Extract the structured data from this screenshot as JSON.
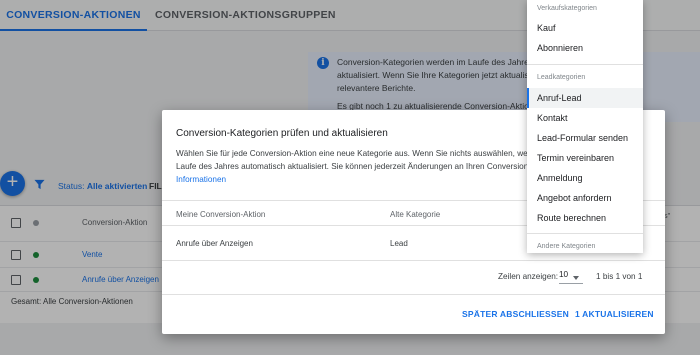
{
  "tabs": [
    {
      "label": "CONVERSION-AKTIONEN",
      "active": true
    },
    {
      "label": "CONVERSION-AKTIONSGRUPPEN",
      "active": false
    }
  ],
  "info": {
    "line1": "Conversion-Kategorien werden im Laufe des Jahres",
    "line2": "aktualisiert. Wenn Sie Ihre Kategorien jetzt aktualisie",
    "line3": "relevantere Berichte.",
    "line4": "Es gibt noch 1 zu aktualisierende Conversion-Aktion"
  },
  "toolbar": {
    "add_label": "+",
    "status_prefix": "Status:",
    "status_value": "Alle aktivierten",
    "filter_label": "FIL"
  },
  "table": {
    "header": "Conversion-Aktion",
    "rows": [
      {
        "name": "Vente",
        "status_color": "#1e8e3e"
      },
      {
        "name": "Anrufe über Anzeigen",
        "status_color": "#1e8e3e"
      }
    ],
    "total": "Gesamt: Alle Conversion-Aktionen",
    "right_col_line1": "nsions\"",
    "right_col_line2": "en"
  },
  "modal": {
    "title": "Conversion-Kategorien prüfen und aktualisieren",
    "desc_line1": "Wählen Sie für jede Conversion-Aktion eine neue Kategorie aus. Wenn Sie nichts auswählen, wer",
    "desc_line2": "Laufe des Jahres automatisch aktualisiert. Sie können jederzeit Änderungen an Ihren Conversion",
    "desc_link": "Informationen",
    "col_action": "Meine Conversion-Aktion",
    "col_old": "Alte Kategorie",
    "row_action": "Anrufe über Anzeigen",
    "row_old": "Lead",
    "rows_label": "Zeilen anzeigen:",
    "rows_value": "10",
    "range": "1 bis 1 von 1",
    "btn_later": "SPÄTER ABSCHLIESSEN",
    "btn_update": "1 AKTUALISIEREN"
  },
  "menu": {
    "group1": "Verkaufskategorien",
    "items1": [
      "Kauf",
      "Abonnieren"
    ],
    "group2": "Leadkategorien",
    "items2": [
      "Anruf-Lead",
      "Kontakt",
      "Lead-Formular senden",
      "Termin vereinbaren",
      "Anmeldung",
      "Angebot anfordern",
      "Route berechnen"
    ],
    "selected": "Anruf-Lead",
    "group3": "Andere Kategorien"
  },
  "colors": {
    "accent": "#1a73e8",
    "status_active": "#1e8e3e"
  }
}
